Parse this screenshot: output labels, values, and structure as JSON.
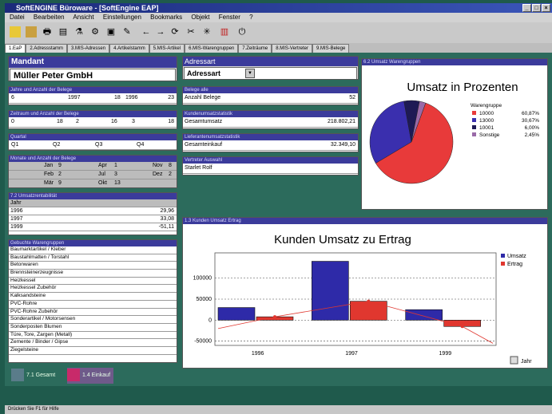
{
  "window": {
    "title": "SoftENGINE Büroware - [SoftEngine EAP]"
  },
  "menu": [
    "Datei",
    "Bearbeiten",
    "Ansicht",
    "Einstellungen",
    "Bookmarks",
    "Objekt",
    "Fenster",
    "?"
  ],
  "tabs": [
    "1.EaP",
    "2.Adressstamm",
    "3.MIS-Adressen",
    "4.Artikelstamm",
    "5.MIS-Artikel",
    "6.MIS-Warengruppen",
    "7.Zeiträume",
    "8.MIS-Vertreter",
    "9.MIS-Belege"
  ],
  "mandant": {
    "title": "Mandant",
    "name": "Müller Peter GmbH"
  },
  "belege_jahr": {
    "title": "Jahre und Anzahl der Belege",
    "cells": [
      "6",
      "1997",
      "18",
      "1996",
      "23"
    ]
  },
  "belege_zeitraum": {
    "title": "Zeitraum und Anzahl der Belege",
    "cells": [
      "0",
      "18",
      "2",
      "16",
      "3",
      "18"
    ]
  },
  "quartal": {
    "title": "Quartal",
    "cells": [
      "Q1",
      "Q2",
      "Q3",
      "Q4"
    ]
  },
  "monate": {
    "title": "Monate und Anzahl der Belege",
    "rows": [
      [
        "Jan",
        "9",
        "Apr",
        "1",
        "Nov",
        "8"
      ],
      [
        "Feb",
        "2",
        "Jul",
        "3",
        "Dez",
        "2"
      ],
      [
        "Mär",
        "9",
        "Okt",
        "13",
        "",
        ""
      ]
    ]
  },
  "umsatzrent": {
    "title": "7.2 Umsatzrentabilität",
    "header": "Jahr",
    "rows": [
      {
        "year": "1996",
        "value": "29,96"
      },
      {
        "year": "1997",
        "value": "33,08"
      },
      {
        "year": "1999",
        "value": "-51,11"
      }
    ]
  },
  "warengruppen": {
    "title": "Gebuchte Warengruppen",
    "items": [
      "Baumarktartikel / Kleber",
      "Baustahlmatten / Torstahl",
      "Betonwaren",
      "Brennsteinerzeugnisse",
      "Heizkessel",
      "Heizkessel Zubehör",
      "Kalksandsteine",
      "PVC-Rohre",
      "PVC-Rohre Zubehör",
      "Sonderartikel / Motorsensen",
      "Sonderposten Blumen",
      "Türe, Tore, Zargen (Metall)",
      "Zemente / Binder / Gipse",
      "Ziegelsteine"
    ]
  },
  "adressart": {
    "title": "Adressart",
    "value": "Adressart",
    "selector": "▼"
  },
  "belege_alle": {
    "title": "Belege alle",
    "label": "Anzahl Belege",
    "value": "52"
  },
  "kundenumsatz": {
    "title": "Kundenumsatzstatistik",
    "label": "Gesamtumsatz",
    "value": "218.802,21"
  },
  "lieferanten": {
    "title": "Lieferantenumsatzstatistik",
    "label": "Gesamteinkauf",
    "value": "32.349,10"
  },
  "vertreter": {
    "title": "Vertreter Auswahl",
    "value": "Starlet Rolf"
  },
  "pie_panel": {
    "title": "6.2 Umsatz Warengruppen"
  },
  "bar_panel": {
    "title": "1.3 Kunden Umsatz Ertrag"
  },
  "chart_data": [
    {
      "type": "pie",
      "title": "Umsatz in Prozenten",
      "legend_title": "Warengruppe",
      "slices": [
        {
          "label": "10000",
          "value": 60.87,
          "pct": "60,87%",
          "color": "#e83a3a"
        },
        {
          "label": "13000",
          "value": 30.67,
          "pct": "30,67%",
          "color": "#3a2fae"
        },
        {
          "label": "10001",
          "value": 6.0,
          "pct": "6,00%",
          "color": "#1e1a55"
        },
        {
          "label": "Sonstige",
          "value": 2.45,
          "pct": "2,45%",
          "color": "#9a6aa8"
        }
      ]
    },
    {
      "type": "bar",
      "title": "Kunden Umsatz zu Ertrag",
      "categories": [
        "1996",
        "1997",
        "1999"
      ],
      "series": [
        {
          "name": "Umsatz",
          "values": [
            30000,
            140000,
            25000
          ],
          "color": "#2e2aa8"
        },
        {
          "name": "Ertrag",
          "values": [
            8000,
            45000,
            -15000
          ],
          "color": "#e0372f"
        }
      ],
      "ylim": [
        -60000,
        160000
      ],
      "yticks": [
        "100000",
        "50000",
        "0",
        "-50000"
      ],
      "ytick_values": [
        100000,
        50000,
        0,
        -50000
      ],
      "xlabel": "Jahr"
    }
  ],
  "taskbar": {
    "items": [
      "7.1 Gesamt",
      "1.4 Einkauf"
    ]
  },
  "status": {
    "left": "Drücken Sie F1 für Hilfe"
  }
}
